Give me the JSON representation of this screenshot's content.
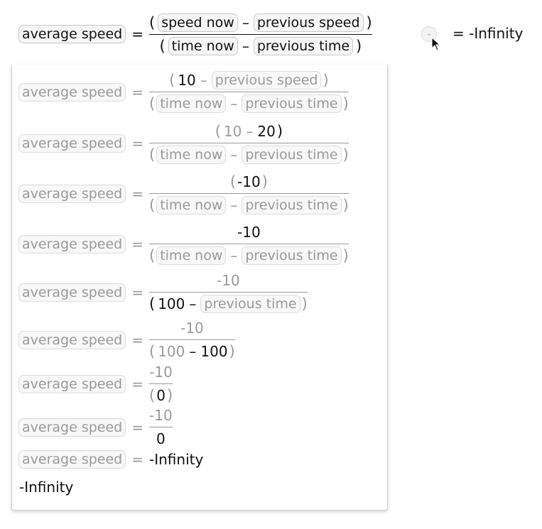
{
  "header": {
    "lhs": "average speed",
    "eq": "=",
    "lp": "(",
    "rp": ")",
    "minus": "–",
    "speed_now": "speed now",
    "previous_speed": "previous speed",
    "time_now": "time now",
    "previous_time": "previous time",
    "result": "= -Infinity"
  },
  "toggle": {
    "icon": "chevron-down-icon",
    "glyph": "⌄"
  },
  "steps": {
    "s1": {
      "num_a": "10"
    },
    "s2": {
      "num_a": "10",
      "num_b": "20"
    },
    "s3": {
      "num": "-10"
    },
    "s4": {
      "num": "-10"
    },
    "s5": {
      "num": "-10",
      "den_a": "100"
    },
    "s6": {
      "num": "-10",
      "den_a": "100",
      "den_b": "100"
    },
    "s7": {
      "num": "-10",
      "den": "0"
    },
    "s8": {
      "num": "-10",
      "den": "0"
    },
    "s9": {
      "value": "-Infinity"
    }
  },
  "final": "-Infinity"
}
